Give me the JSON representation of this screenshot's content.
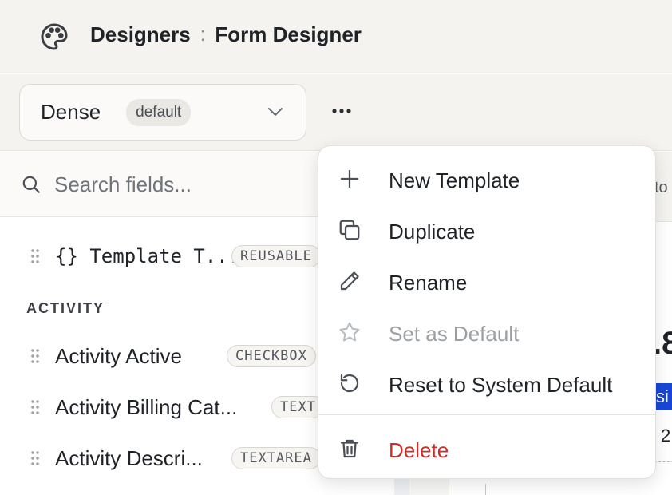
{
  "header": {
    "breadcrumb": [
      {
        "label": "Designers"
      },
      {
        "separator": ":"
      },
      {
        "label": "Form Designer"
      }
    ],
    "icon": "palette-icon"
  },
  "toolbar": {
    "template_name": "Dense",
    "template_badge": "default",
    "more_icon": "ellipsis-icon"
  },
  "search": {
    "placeholder": "Search fields..."
  },
  "fields": {
    "top_item": {
      "label": "{} Template T...",
      "type": "REUSABLE"
    },
    "section": "ACTIVITY",
    "items": [
      {
        "label": "Activity Active",
        "type": "CHECKBOX"
      },
      {
        "label": "Activity Billing Cat...",
        "type": "TEXT"
      },
      {
        "label": "Activity Descri...",
        "type": "TEXTAREA"
      }
    ]
  },
  "right_panel": {
    "partial_top_text": "to",
    "partial_big_text": ".8",
    "partial_blue_text": "si",
    "partial_number": "2"
  },
  "menu": {
    "items": [
      {
        "label": "New Template",
        "icon": "plus-icon"
      },
      {
        "label": "Duplicate",
        "icon": "copy-icon"
      },
      {
        "label": "Rename",
        "icon": "pencil-icon"
      },
      {
        "label": "Set as Default",
        "icon": "star-icon",
        "disabled": true
      },
      {
        "label": "Reset to System Default",
        "icon": "reset-icon"
      },
      {
        "label": "Delete",
        "icon": "trash-icon",
        "danger": true
      }
    ]
  },
  "colors": {
    "danger": "#c9302c",
    "disabled": "#9b9ea3",
    "accent_blue": "#1747d6"
  }
}
